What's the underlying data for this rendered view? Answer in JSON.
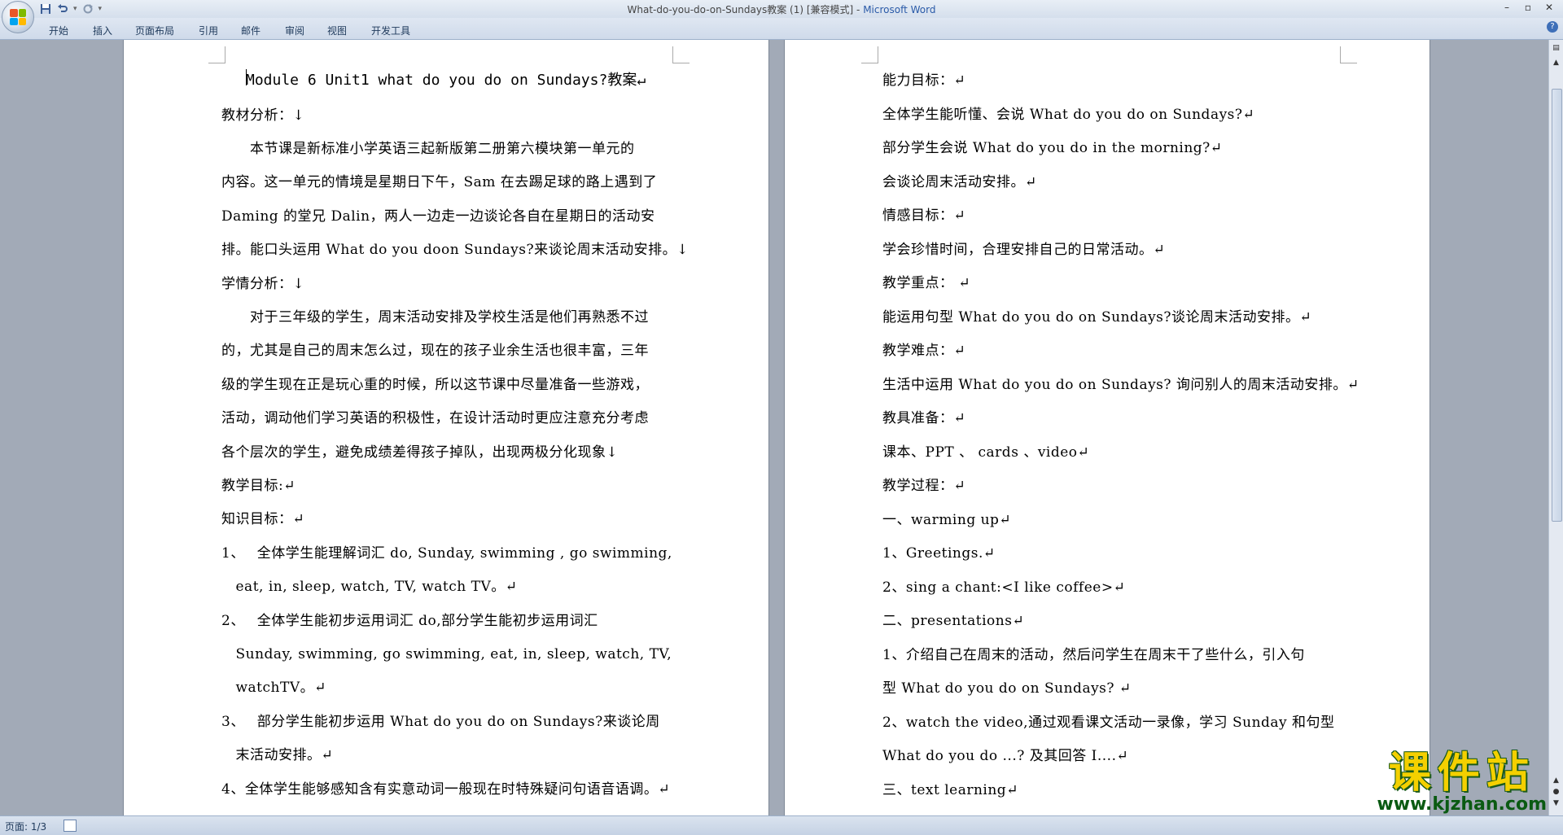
{
  "window": {
    "doc_title": "What-do-you-do-on-Sundays教案 (1) [兼容模式]",
    "app_name": "Microsoft Word",
    "separator": " - "
  },
  "qat": {
    "save": "save-icon",
    "undo": "undo-icon",
    "redo": "redo-icon",
    "customize": "▾"
  },
  "ribbon": {
    "tabs": [
      "开始",
      "插入",
      "页面布局",
      "引用",
      "邮件",
      "审阅",
      "视图",
      "开发工具"
    ]
  },
  "help_icon": "?",
  "document": {
    "left_page": [
      "Module 6 Unit1 what do you do on Sundays?教案↵",
      "教材分析：↓",
      "　　本节课是新标准小学英语三起新版第二册第六模块第一单元的",
      "内容。这一单元的情境是星期日下午，Sam 在去踢足球的路上遇到了",
      "Daming 的堂兄 Dalin，两人一边走一边谈论各自在星期日的活动安",
      "排。能口头运用 What do you doon Sundays?来谈论周末活动安排。↓",
      "学情分析：↓",
      "　　对于三年级的学生，周末活动安排及学校生活是他们再熟悉不过",
      "的，尤其是自己的周末怎么过，现在的孩子业余生活也很丰富，三年",
      "级的学生现在正是玩心重的时候，所以这节课中尽量准备一些游戏，",
      "活动，调动他们学习英语的积极性，在设计活动时更应注意充分考虑",
      "各个层次的学生，避免成绩差得孩子掉队，出现两极分化现象↓",
      "教学目标:↵",
      "知识目标：↵",
      "1、　 全体学生能理解词汇 do, Sunday, swimming , go swimming,",
      "　eat, in, sleep, watch, TV, watch TV。↵",
      "2、　 全体学生能初步运用词汇 do,部分学生能初步运用词汇",
      "　Sunday, swimming, go swimming, eat, in, sleep, watch, TV,",
      "　watchTV。↵",
      "3、　 部分学生能初步运用 What do you do on Sundays?来谈论周",
      "　末活动安排。↵",
      "4、全体学生能够感知含有实意动词一般现在时特殊疑问句语音语调。↵"
    ],
    "right_page": [
      "能力目标：↵",
      "全体学生能听懂、会说 What do you do on Sundays?↵",
      "部分学生会说 What do you do in the morning?↵",
      "会谈论周末活动安排。↵",
      "情感目标：↵",
      "学会珍惜时间，合理安排自己的日常活动。↵",
      "教学重点： ↵",
      "能运用句型 What do you do on Sundays?谈论周末活动安排。↵",
      "教学难点：↵",
      "生活中运用 What do you do on Sundays? 询问别人的周末活动安排。↵",
      "教具准备：↵",
      "课本、PPT 、 cards 、video↵",
      "教学过程：↵",
      "一、warming up↵",
      "1、Greetings.↵",
      "2、sing a chant:<I like coffee>↵",
      "二、presentations↵",
      "1、介绍自己在周末的活动，然后问学生在周末干了些什么，引入句",
      "型 What do you do on Sundays? ↵",
      "2、watch the video,通过观看课文活动一录像，学习 Sunday 和句型",
      "What do you do ...? 及其回答 I....↵",
      "三、text learning↵"
    ]
  },
  "statusbar": {
    "page_count": "页面: 1/3"
  },
  "watermark": {
    "main": "课件站",
    "url": "www.kjzhan.com"
  }
}
